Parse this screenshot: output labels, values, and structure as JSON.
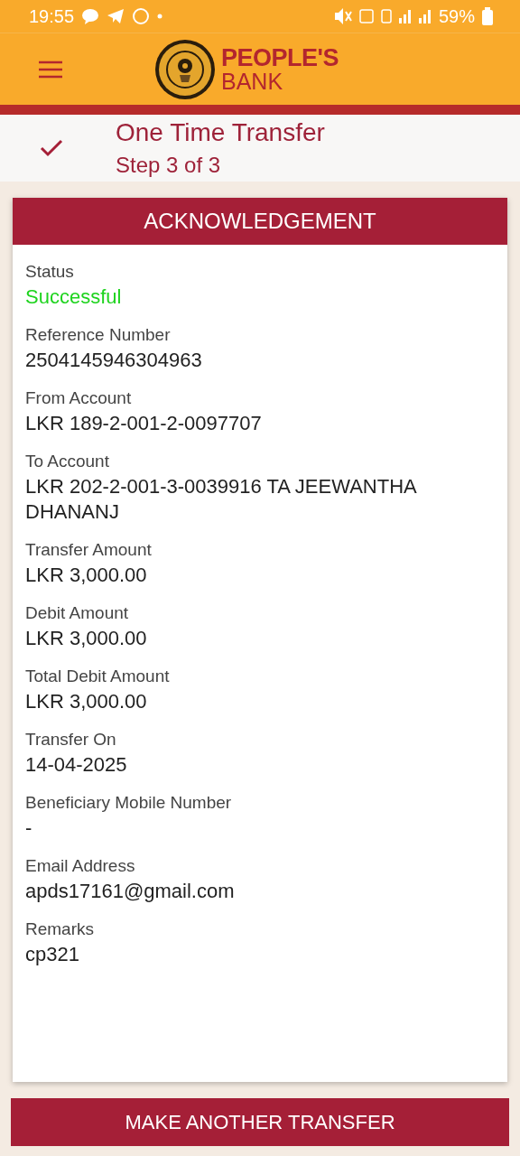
{
  "status_bar": {
    "time": "19:55",
    "battery": "59%"
  },
  "header": {
    "brand_line_1": "PEOPLE'S",
    "brand_line_2": "BANK"
  },
  "step": {
    "title": "One Time Transfer",
    "subtitle": "Step 3 of 3",
    "completed": true
  },
  "card": {
    "title": "ACKNOWLEDGEMENT",
    "fields": [
      {
        "label": "Status",
        "value": "Successful",
        "kind": "status"
      },
      {
        "label": "Reference Number",
        "value": "2504145946304963",
        "kind": "text"
      },
      {
        "label": "From Account",
        "value": "LKR 189-2-001-2-0097707",
        "kind": "text"
      },
      {
        "label": "To Account",
        "value": "LKR 202-2-001-3-0039916 TA JEEWANTHA DHANANJ",
        "kind": "text"
      },
      {
        "label": "Transfer Amount",
        "value": "LKR 3,000.00",
        "kind": "text"
      },
      {
        "label": "Debit Amount",
        "value": "LKR 3,000.00",
        "kind": "text"
      },
      {
        "label": "Total Debit Amount",
        "value": "LKR 3,000.00",
        "kind": "text"
      },
      {
        "label": "Transfer On",
        "value": "14-04-2025",
        "kind": "text"
      },
      {
        "label": "Beneficiary Mobile Number",
        "value": "-",
        "kind": "text"
      },
      {
        "label": "Email Address",
        "value": "apds17161@gmail.com",
        "kind": "text"
      },
      {
        "label": "Remarks",
        "value": "cp321",
        "kind": "text"
      }
    ]
  },
  "button": "MAKE ANOTHER TRANSFER"
}
